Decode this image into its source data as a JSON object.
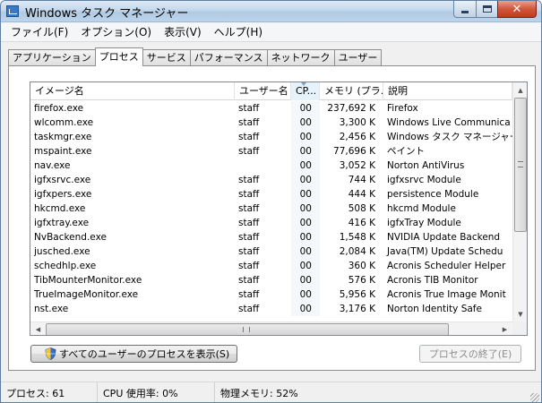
{
  "window": {
    "title": "Windows タスク マネージャー",
    "close_glyph": "✕"
  },
  "menu": {
    "items": [
      "ファイル(F)",
      "オプション(O)",
      "表示(V)",
      "ヘルプ(H)"
    ]
  },
  "tabs": {
    "items": [
      "アプリケーション",
      "プロセス",
      "サービス",
      "パフォーマンス",
      "ネットワーク",
      "ユーザー"
    ],
    "active": "プロセス"
  },
  "process_list": {
    "columns": {
      "name": "イメージ名",
      "user": "ユーザー名",
      "cpu": "CP...",
      "memory": "メモリ (プラ...",
      "description": "説明"
    },
    "sorted_column": "cpu",
    "rows": [
      {
        "name": "firefox.exe",
        "user": "staff",
        "cpu": "00",
        "memory": "237,692 K",
        "description": "Firefox"
      },
      {
        "name": "wlcomm.exe",
        "user": "staff",
        "cpu": "00",
        "memory": "3,300 K",
        "description": "Windows Live Communica"
      },
      {
        "name": "taskmgr.exe",
        "user": "staff",
        "cpu": "00",
        "memory": "2,456 K",
        "description": "Windows タスク マネージャー"
      },
      {
        "name": "mspaint.exe",
        "user": "staff",
        "cpu": "00",
        "memory": "77,696 K",
        "description": "ペイント"
      },
      {
        "name": "nav.exe",
        "user": "",
        "cpu": "00",
        "memory": "3,052 K",
        "description": "Norton AntiVirus"
      },
      {
        "name": "igfxsrvc.exe",
        "user": "staff",
        "cpu": "00",
        "memory": "744 K",
        "description": "igfxsrvc Module"
      },
      {
        "name": "igfxpers.exe",
        "user": "staff",
        "cpu": "00",
        "memory": "444 K",
        "description": "persistence Module"
      },
      {
        "name": "hkcmd.exe",
        "user": "staff",
        "cpu": "00",
        "memory": "508 K",
        "description": "hkcmd Module"
      },
      {
        "name": "igfxtray.exe",
        "user": "staff",
        "cpu": "00",
        "memory": "416 K",
        "description": "igfxTray Module"
      },
      {
        "name": "NvBackend.exe",
        "user": "staff",
        "cpu": "00",
        "memory": "1,548 K",
        "description": "NVIDIA Update Backend"
      },
      {
        "name": "jusched.exe",
        "user": "staff",
        "cpu": "00",
        "memory": "2,084 K",
        "description": "Java(TM) Update Schedu"
      },
      {
        "name": "schedhlp.exe",
        "user": "staff",
        "cpu": "00",
        "memory": "360 K",
        "description": "Acronis Scheduler Helper"
      },
      {
        "name": "TibMounterMonitor.exe",
        "user": "staff",
        "cpu": "00",
        "memory": "576 K",
        "description": "Acronis TIB Monitor"
      },
      {
        "name": "TrueImageMonitor.exe",
        "user": "staff",
        "cpu": "00",
        "memory": "5,956 K",
        "description": "Acronis True Image Monit"
      },
      {
        "name": "nst.exe",
        "user": "staff",
        "cpu": "00",
        "memory": "3,176 K",
        "description": "Norton Identity Safe"
      }
    ]
  },
  "buttons": {
    "show_all": "すべてのユーザーのプロセスを表示(S)",
    "end_process": "プロセスの終了(E)"
  },
  "statusbar": {
    "processes": "プロセス: 61",
    "cpu_usage": "CPU 使用率: 0%",
    "memory": "物理メモリ: 52%"
  },
  "colors": {
    "titlebar": "#c4d8ec",
    "close_button": "#c23a1e",
    "sorted_column": "#e7f3fb"
  },
  "icons": {
    "app": "task-manager-icon",
    "shield": "uac-shield-icon"
  }
}
